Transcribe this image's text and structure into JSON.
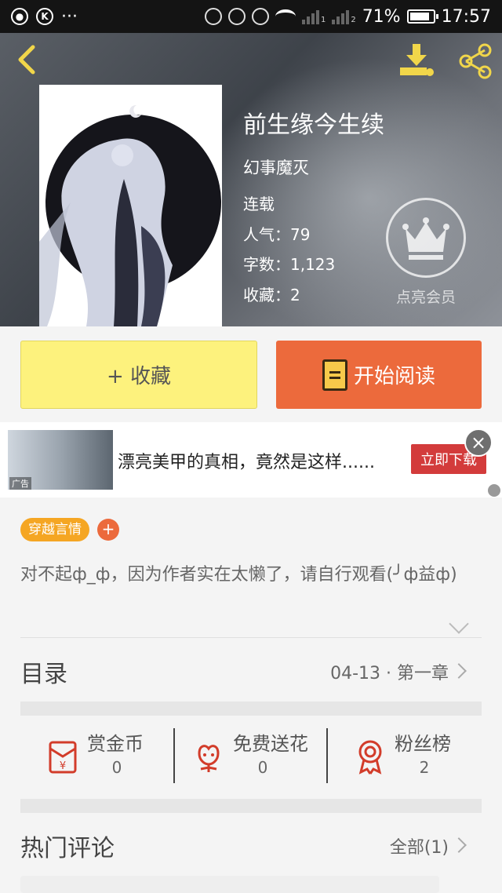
{
  "status_bar": {
    "battery": "71%",
    "time": "17:57",
    "signal1": "1",
    "signal2": "2"
  },
  "book": {
    "title": "前生缘今生续",
    "author": "幻事魔灭",
    "status": "连载",
    "popularity": "人气：79",
    "word_count": "字数：1,123",
    "favorites": "收藏：2"
  },
  "vip": {
    "label": "点亮会员"
  },
  "actions": {
    "favorite_label": "+ 收藏",
    "read_label": "开始阅读"
  },
  "ad": {
    "headline": "漂亮美甲的真相，竟然是这样......",
    "cta": "立即下载",
    "tag": "广告"
  },
  "tag": {
    "genre": "穿越言情",
    "add_symbol": "+"
  },
  "description": "对不起ф_ф，因为作者实在太懒了，请自行观看(╯ф益ф)",
  "toc": {
    "title": "目录",
    "latest": "04-13 · 第一章"
  },
  "rewards": [
    {
      "label": "赏金币",
      "value": "0",
      "icon": "red-envelope-icon"
    },
    {
      "label": "免费送花",
      "value": "0",
      "icon": "flower-icon"
    },
    {
      "label": "粉丝榜",
      "value": "2",
      "icon": "medal-icon"
    }
  ],
  "comments": {
    "title": "热门评论",
    "all": "全部(1)"
  },
  "colors": {
    "yellow": "#fdf27d",
    "orange": "#ec6a3c",
    "tag": "#f5a623",
    "accent_icon": "#f1d64a",
    "reward_red": "#d23c2a"
  }
}
